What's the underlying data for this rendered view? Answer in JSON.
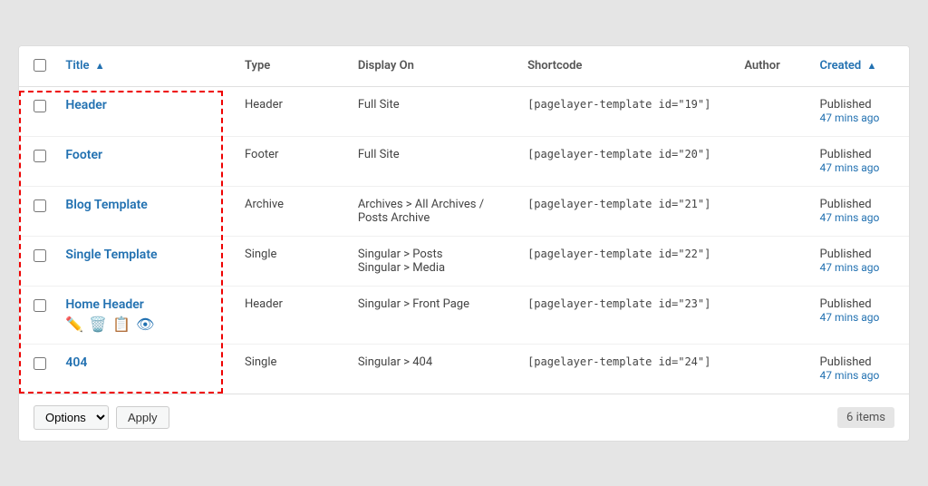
{
  "table": {
    "columns": {
      "title": "Title",
      "type": "Type",
      "display_on": "Display On",
      "shortcode": "Shortcode",
      "author": "Author",
      "created": "Created"
    },
    "sort_indicators": {
      "title": "▲",
      "created": "▲"
    },
    "rows": [
      {
        "id": 1,
        "title": "Header",
        "type": "Header",
        "display_on": "Full Site",
        "shortcode": "[pagelayer-template id=\"19\"]",
        "author": "",
        "status": "Published",
        "time": "47 mins ago"
      },
      {
        "id": 2,
        "title": "Footer",
        "type": "Footer",
        "display_on": "Full Site",
        "shortcode": "[pagelayer-template id=\"20\"]",
        "author": "",
        "status": "Published",
        "time": "47 mins ago"
      },
      {
        "id": 3,
        "title": "Blog Template",
        "type": "Archive",
        "display_on": "Archives > All Archives / Posts Archive",
        "shortcode": "[pagelayer-template id=\"21\"]",
        "author": "",
        "status": "Published",
        "time": "47 mins ago"
      },
      {
        "id": 4,
        "title": "Single Template",
        "type": "Single",
        "display_on": "Singular > Posts\nSingular > Media",
        "shortcode": "[pagelayer-template id=\"22\"]",
        "author": "",
        "status": "Published",
        "time": "47 mins ago"
      },
      {
        "id": 5,
        "title": "Home Header",
        "type": "Header",
        "display_on": "Singular > Front Page",
        "shortcode": "[pagelayer-template id=\"23\"]",
        "author": "",
        "status": "Published",
        "time": "47 mins ago",
        "show_actions": true
      },
      {
        "id": 6,
        "title": "404",
        "type": "Single",
        "display_on": "Singular > 404",
        "shortcode": "[pagelayer-template id=\"24\"]",
        "author": "",
        "status": "Published",
        "time": "47 mins ago"
      }
    ]
  },
  "footer": {
    "options_label": "Options",
    "apply_label": "Apply",
    "items_label": "6 items"
  }
}
